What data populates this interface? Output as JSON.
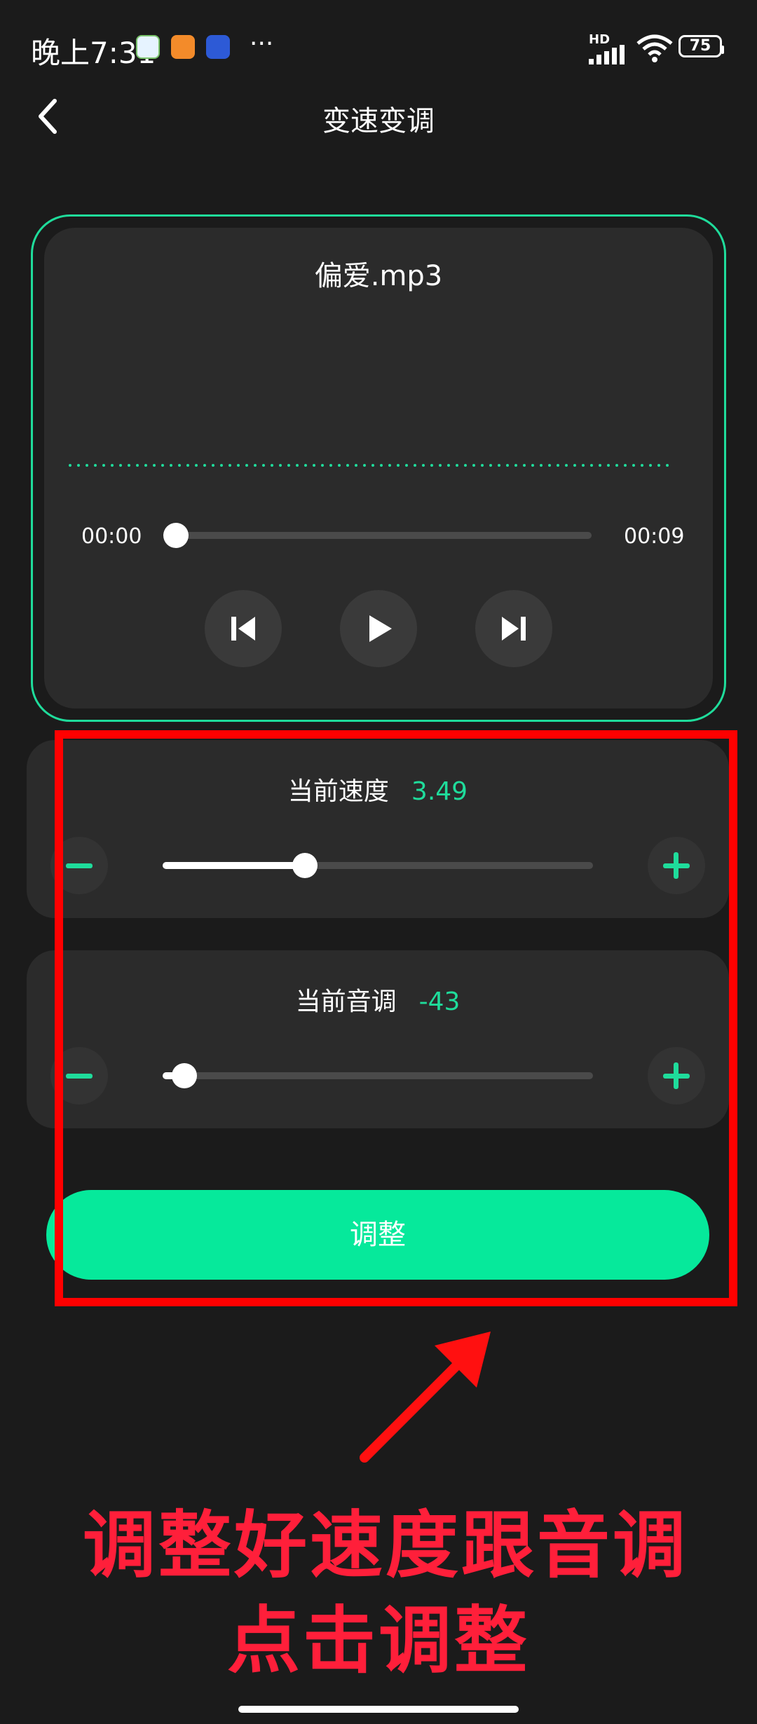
{
  "status_bar": {
    "time": "晚上7:31",
    "more": "···",
    "network": "HD",
    "battery": "75"
  },
  "header": {
    "title": "变速变调"
  },
  "player": {
    "file_name": "偏爱.mp3",
    "current_time": "00:00",
    "total_time": "00:09",
    "progress": 0.0
  },
  "speed": {
    "label": "当前速度",
    "value": "3.49",
    "slider_fraction": 0.33
  },
  "pitch": {
    "label": "当前音调",
    "value": "-43",
    "slider_fraction": 0.05
  },
  "apply_button": {
    "label": "调整"
  },
  "annotation": {
    "line1": "调整好速度跟音调",
    "line2": "点击调整"
  },
  "colors": {
    "accent": "#1fdc9b",
    "button": "#06e99b",
    "annotation": "#ff0000"
  }
}
